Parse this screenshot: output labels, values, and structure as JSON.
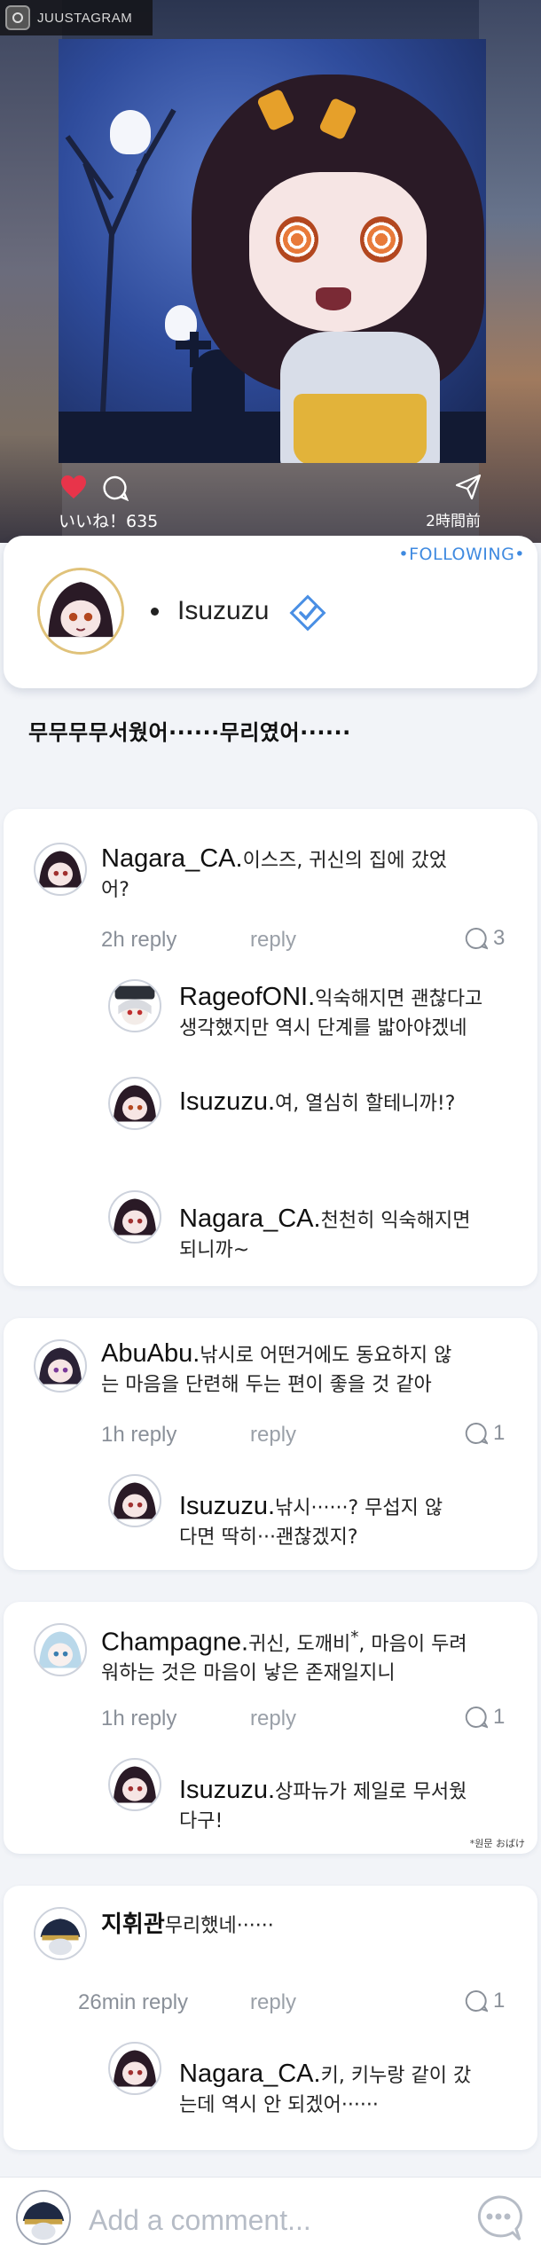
{
  "app": {
    "brand": "JUUSTAGRAM"
  },
  "post": {
    "likes_label": "いいね！635",
    "time_label": "2時間前",
    "author": "Isuzuzu",
    "follow_label": "•FOLLOWING•",
    "caption": "무무무무서웠어······무리였어······"
  },
  "threads": [
    {
      "comment": {
        "user": "Nagara_CA.",
        "text": "이스즈, 귀신의 집에 갔었",
        "text2": "어?",
        "time": "2h reply",
        "reply": "reply",
        "count": "3"
      },
      "replies": [
        {
          "user": "RageofONI.",
          "text": "익숙해지면 괜찮다고",
          "text2": "생각했지만 역시 단계를 밟아야겠네"
        },
        {
          "user": "Isuzuzu.",
          "text": "여, 열심히 할테니까!?",
          "text2": ""
        },
        {
          "user": "Nagara_CA.",
          "text": "천천히 익숙해지면",
          "text2": "되니까~"
        }
      ]
    },
    {
      "comment": {
        "user": "AbuAbu.",
        "text": "낚시로 어떤거에도 동요하지 않",
        "text2": "는 마음을 단련해 두는 편이 좋을 것 같아",
        "time": "1h reply",
        "reply": "reply",
        "count": "1"
      },
      "replies": [
        {
          "user": "Isuzuzu.",
          "text": "낚시······? 무섭지 않",
          "text2": "다면 딱히···괜찮겠지?"
        }
      ]
    },
    {
      "comment": {
        "user": "Champagne.",
        "text": "귀신, 도깨비",
        "mark": "*",
        "text_after": ", 마음이 두려",
        "text2": "워하는 것은 마음이 낳은 존재일지니",
        "time": "1h reply",
        "reply": "reply",
        "count": "1"
      },
      "replies": [
        {
          "user": "Isuzuzu.",
          "text": "상파뉴가 제일로 무서웠",
          "text2": "다구!"
        }
      ],
      "note": "*원문 おばけ"
    },
    {
      "comment": {
        "user": "지휘관",
        "text": "무리했네······",
        "text2": "",
        "time": "26min reply",
        "reply": "reply",
        "count": "1"
      },
      "replies": [
        {
          "user": "Nagara_CA.",
          "text": "키, 키누랑 같이 갔",
          "text2": "는데 역시 안 되겠어······"
        }
      ]
    }
  ],
  "composer": {
    "placeholder": "Add a comment..."
  },
  "colors": {
    "accent": "#3f8ae0",
    "heart": "#e8344a",
    "meta": "#8a9099"
  },
  "icons": [
    "heart-icon",
    "comment-icon",
    "send-icon",
    "verified-icon",
    "chat-icon"
  ]
}
